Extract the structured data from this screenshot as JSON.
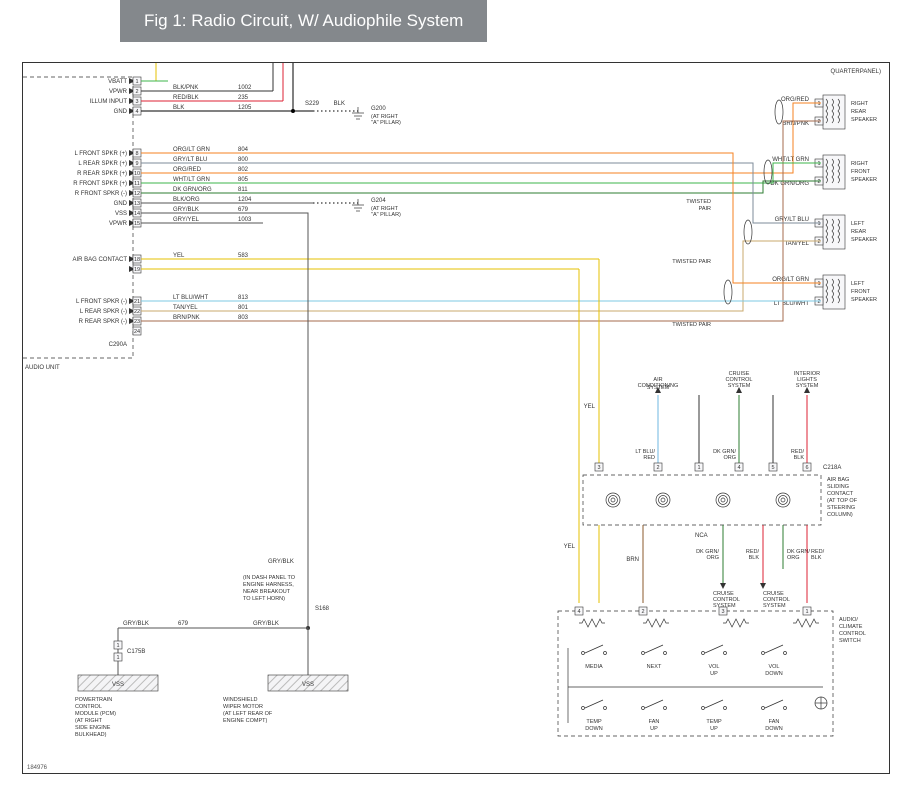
{
  "title": "Fig 1: Radio Circuit, W/ Audiophile System",
  "doc_id": "184976",
  "quarterpanel": "QUARTERPANEL)",
  "audio_unit": {
    "label": "AUDIO UNIT",
    "connector": "C290A"
  },
  "pins_top": [
    {
      "n": "1",
      "label": "VBATT",
      "color": "",
      "code": ""
    },
    {
      "n": "2",
      "label": "VPWR",
      "color": "BLK/PNK",
      "code": "1002"
    },
    {
      "n": "3",
      "label": "ILLUM INPUT",
      "color": "RED/BLK",
      "code": "235"
    },
    {
      "n": "4",
      "label": "GND",
      "color": "BLK",
      "code": "1205"
    }
  ],
  "s229_label": "S229",
  "g200": {
    "id": "G200",
    "loc": "(AT RIGHT\n\"A\" PILLAR)"
  },
  "g204": {
    "id": "G204",
    "loc": "(AT RIGHT\n\"A\" PILLAR)"
  },
  "pins_mid": [
    {
      "n": "8",
      "label": "L FRONT SPKR (+)",
      "color": "ORG/LT GRN",
      "code": "804",
      "wire": "#f58220"
    },
    {
      "n": "9",
      "label": "L REAR SPKR (+)",
      "color": "GRY/LT BLU",
      "code": "800",
      "wire": "#7d8b99"
    },
    {
      "n": "10",
      "label": "R REAR SPKR (+)",
      "color": "ORG/RED",
      "code": "802",
      "wire": "#f58220"
    },
    {
      "n": "11",
      "label": "R FRONT SPKR (+)",
      "color": "WHT/LT GRN",
      "code": "805",
      "wire": "#3cb44b"
    },
    {
      "n": "12",
      "label": "R FRONT SPKR (-)",
      "color": "DK GRN/ORG",
      "code": "811",
      "wire": "#2e7d32"
    },
    {
      "n": "13",
      "label": "GND",
      "color": "BLK/ORG",
      "code": "1204",
      "wire": "#555"
    },
    {
      "n": "14",
      "label": "VSS",
      "color": "GRY/BLK",
      "code": "679",
      "wire": "#555"
    },
    {
      "n": "15",
      "label": "VPWR",
      "color": "GRY/YEL",
      "code": "1003",
      "wire": "#555"
    }
  ],
  "pin18": {
    "n": "18",
    "label": "AIR BAG CONTACT",
    "color": "YEL",
    "code": "583",
    "wire": "#e6c200"
  },
  "pin19": {
    "n": "19",
    "label": "",
    "wire": "#e6c200"
  },
  "pins_bot": [
    {
      "n": "21",
      "label": "L FRONT SPKR (-)",
      "color": "LT BLU/WHT",
      "code": "813",
      "wire": "#7ec8e3"
    },
    {
      "n": "22",
      "label": "L REAR SPKR (-)",
      "color": "TAN/YEL",
      "code": "801",
      "wire": "#c9a96e"
    },
    {
      "n": "23",
      "label": "R REAR SPKR (-)",
      "color": "BRN/PNK",
      "code": "803",
      "wire": "#a46b4e"
    }
  ],
  "pin24": {
    "n": "24"
  },
  "speakers": [
    {
      "id": "right-rear",
      "label": "RIGHT\nREAR\nSPEAKER",
      "top": "ORG/RED",
      "bot": "BRN/PNK"
    },
    {
      "id": "right-front",
      "label": "RIGHT\nFRONT\nSPEAKER",
      "top": "WHT/LT GRN",
      "bot": "DK GRN/ORG"
    },
    {
      "id": "left-rear",
      "label": "LEFT\nREAR\nSPEAKER",
      "top": "GRY/LT BLU",
      "bot": "TAN/YEL"
    },
    {
      "id": "left-front",
      "label": "LEFT\nFRONT\nSPEAKER",
      "top": "ORG/LT GRN",
      "bot": "LT BLU/WHT"
    }
  ],
  "twisted_pair": "TWISTED\nPAIR",
  "systems": {
    "ac": "AIR\nCONDITIONING\nSYSTEM",
    "cruise": "CRUISE\nCONTROL\nSYSTEM",
    "lights": "INTERIOR\nLIGHTS\nSYSTEM"
  },
  "c218a": "C218A",
  "c218_wires": {
    "w1": "YEL",
    "w2": "LT BLU/\nRED",
    "w3": "",
    "w4": "DK GRN/\nORG",
    "w5": "",
    "w6": "RED/\nBLK"
  },
  "airbag_contact": {
    "label": "AIR BAG\nSLIDING\nCONTACT\n(AT TOP OF\nSTEERING\nCOLUMN)",
    "nca": "NCA"
  },
  "below_contact": {
    "yel": "YEL",
    "brn": "BRN",
    "dkgrn": "DK GRN/\nORG",
    "red1": "RED/\nBLK",
    "dkgrn2": "DK GRN/\nORG",
    "red2": "RED/\nBLK",
    "cruise": "CRUISE\nCONTROL\nSYSTEM"
  },
  "audio_climate": {
    "label": "AUDIO/\nCLIMATE\nCONTROL\nSWITCH",
    "buttons_top": [
      "MEDIA",
      "NEXT",
      "VOL\nUP",
      "VOL\nDOWN"
    ],
    "buttons_bot": [
      "TEMP\nDOWN",
      "FAN\nUP",
      "TEMP\nUP",
      "FAN\nDOWN"
    ]
  },
  "s168": {
    "note": "(IN DASH PANEL TO\nENGINE HARNESS,\nNEAR BREAKOUT\nTO LEFT HORN)",
    "id": "S168"
  },
  "gryblk": "GRY/BLK",
  "c175b": {
    "code": "679",
    "conn": "C175B",
    "pinL": "1",
    "pinR": "1"
  },
  "pcm": {
    "label": "POWERTRAIN\nCONTROL\nMODULE (PCM)\n(AT RIGHT\nSIDE ENGINE\nBULKHEAD)",
    "vss": "VSS"
  },
  "wiper": {
    "label": "WINDSHIELD\nWIPER MOTOR\n(AT LEFT REAR OF\nENGINE COMPT)",
    "vss": "VSS"
  }
}
